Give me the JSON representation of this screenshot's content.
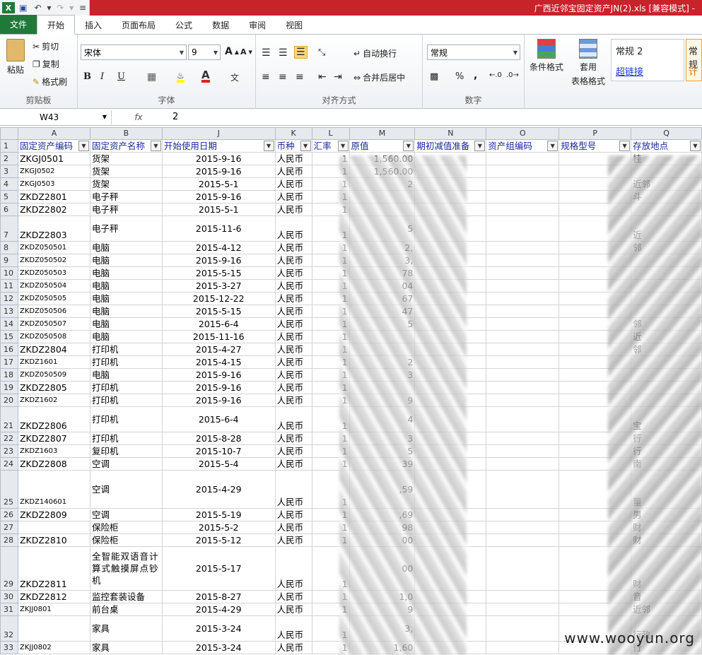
{
  "titlebar": {
    "title": "广西近邻宝固定资产JN(2).xls  [兼容模式] - "
  },
  "tabs": [
    {
      "label": "文件"
    },
    {
      "label": "开始"
    },
    {
      "label": "插入"
    },
    {
      "label": "页面布局"
    },
    {
      "label": "公式"
    },
    {
      "label": "数据"
    },
    {
      "label": "审阅"
    },
    {
      "label": "视图"
    }
  ],
  "ribbon": {
    "clipboard": {
      "paste": "粘贴",
      "cut": "剪切",
      "copy": "复制",
      "format_painter": "格式刷",
      "group": "剪贴板"
    },
    "font": {
      "name": "宋体",
      "size": "9",
      "bold": "B",
      "italic": "I",
      "underline": "U",
      "grow": "A",
      "shrink": "A",
      "group": "字体"
    },
    "alignment": {
      "wrap": "自动换行",
      "merge": "合并后居中",
      "group": "对齐方式"
    },
    "number": {
      "format": "常规",
      "percent": "%",
      "comma": ",",
      "group": "数字"
    },
    "styles": {
      "conditional": "条件格式",
      "table_format_line1": "套用",
      "table_format_line2": "表格格式",
      "style_normal2": "常规 2",
      "hyperlink": "超链接",
      "style_cut1": "常规",
      "style_cut2": "计"
    }
  },
  "formula": {
    "cell_ref": "W43",
    "fx": "fx",
    "value": "2"
  },
  "columns": [
    "A",
    "B",
    "J",
    "K",
    "L",
    "M",
    "N",
    "O",
    "P",
    "Q"
  ],
  "header_row": {
    "num": "1",
    "cells": [
      "固定资产编码",
      "固定资产名称",
      "开始使用日期",
      "币种",
      "汇率",
      "原值",
      "期初减值准备",
      "资产组编码",
      "规格型号",
      "存放地点"
    ]
  },
  "rows": [
    {
      "num": "2",
      "code": "ZKGJ0501",
      "name": "货架",
      "date": "2015-9-16",
      "cur": "人民币",
      "rate": "1",
      "val": "1,560.00",
      "loc": "桂"
    },
    {
      "num": "3",
      "code": "ZKGJ0502",
      "name": "货架",
      "date": "2015-9-16",
      "cur": "人民币",
      "rate": "1",
      "val": "1,560.00",
      "loc": "",
      "small": true
    },
    {
      "num": "4",
      "code": "ZKGJ0503",
      "name": "货架",
      "date": "2015-5-1",
      "cur": "人民币",
      "rate": "1",
      "val": "2",
      "loc": "近邻",
      "small": true
    },
    {
      "num": "5",
      "code": "ZKDZ2801",
      "name": "电子秤",
      "date": "2015-9-16",
      "cur": "人民币",
      "rate": "1",
      "val": "",
      "loc": "斗"
    },
    {
      "num": "6",
      "code": "ZKDZ2802",
      "name": "电子秤",
      "date": "2015-5-1",
      "cur": "人民币",
      "rate": "1",
      "val": "",
      "loc": ""
    },
    {
      "num": "7",
      "code": "ZKDZ2803",
      "name": "电子秤",
      "date": "2015-11-6",
      "cur": "人民币",
      "rate": "1",
      "val": "5",
      "loc": "近",
      "tall": true
    },
    {
      "num": "8",
      "code": "ZKDZ050501",
      "name": "电脑",
      "date": "2015-4-12",
      "cur": "人民币",
      "rate": "1",
      "val": "2,",
      "loc": "邻",
      "small": true
    },
    {
      "num": "9",
      "code": "ZKDZ050502",
      "name": "电脑",
      "date": "2015-9-16",
      "cur": "人民币",
      "rate": "1",
      "val": "3,",
      "loc": "",
      "small": true
    },
    {
      "num": "10",
      "code": "ZKDZ050503",
      "name": "电脑",
      "date": "2015-5-15",
      "cur": "人民币",
      "rate": "1",
      "val": "78",
      "loc": "",
      "small": true
    },
    {
      "num": "11",
      "code": "ZKDZ050504",
      "name": "电脑",
      "date": "2015-3-27",
      "cur": "人民币",
      "rate": "1",
      "val": "04",
      "loc": "",
      "small": true
    },
    {
      "num": "12",
      "code": "ZKDZ050505",
      "name": "电脑",
      "date": "2015-12-22",
      "cur": "人民币",
      "rate": "1",
      "val": "67",
      "loc": "",
      "small": true
    },
    {
      "num": "13",
      "code": "ZKDZ050506",
      "name": "电脑",
      "date": "2015-5-15",
      "cur": "人民币",
      "rate": "1",
      "val": "47",
      "loc": "",
      "small": true
    },
    {
      "num": "14",
      "code": "ZKDZ050507",
      "name": "电脑",
      "date": "2015-6-4",
      "cur": "人民币",
      "rate": "1",
      "val": "5",
      "loc": "邻",
      "small": true
    },
    {
      "num": "15",
      "code": "ZKDZ050508",
      "name": "电脑",
      "date": "2015-11-16",
      "cur": "人民币",
      "rate": "1",
      "val": "",
      "loc": "近",
      "small": true
    },
    {
      "num": "16",
      "code": "ZKDZ2804",
      "name": "打印机",
      "date": "2015-4-27",
      "cur": "人民币",
      "rate": "1",
      "val": "",
      "loc": "邻"
    },
    {
      "num": "17",
      "code": "ZKDZ1601",
      "name": "打印机",
      "date": "2015-4-15",
      "cur": "人民币",
      "rate": "1",
      "val": "2",
      "loc": "",
      "small": true
    },
    {
      "num": "18",
      "code": "ZKDZ050509",
      "name": "电脑",
      "date": "2015-9-16",
      "cur": "人民币",
      "rate": "1",
      "val": "3",
      "loc": "",
      "small": true
    },
    {
      "num": "19",
      "code": "ZKDZ2805",
      "name": "打印机",
      "date": "2015-9-16",
      "cur": "人民币",
      "rate": "1",
      "val": "",
      "loc": ""
    },
    {
      "num": "20",
      "code": "ZKDZ1602",
      "name": "打印机",
      "date": "2015-9-16",
      "cur": "人民币",
      "rate": "1",
      "val": "9",
      "loc": "",
      "small": true
    },
    {
      "num": "21",
      "code": "ZKDZ2806",
      "name": "打印机",
      "date": "2015-6-4",
      "cur": "人民币",
      "rate": "1",
      "val": "4",
      "loc": "宝",
      "tall": true
    },
    {
      "num": "22",
      "code": "ZKDZ2807",
      "name": "打印机",
      "date": "2015-8-28",
      "cur": "人民币",
      "rate": "1",
      "val": "3",
      "loc": "行"
    },
    {
      "num": "23",
      "code": "ZKDZ1603",
      "name": "复印机",
      "date": "2015-10-7",
      "cur": "人民币",
      "rate": "1",
      "val": "5",
      "loc": "行",
      "small": true
    },
    {
      "num": "24",
      "code": "ZKDZ2808",
      "name": "空调",
      "date": "2015-5-4",
      "cur": "人民币",
      "rate": "1",
      "val": "39",
      "loc": "南"
    },
    {
      "num": "25",
      "code": "ZKDZ140601",
      "name": "空调",
      "date": "2015-4-29",
      "cur": "人民币",
      "rate": "1",
      "val": ",59",
      "loc": "董",
      "small": true,
      "tall3": true
    },
    {
      "num": "26",
      "code": "ZKDZ2809",
      "name": "空调",
      "date": "2015-5-19",
      "cur": "人民币",
      "rate": "1",
      "val": ",69",
      "loc": "男"
    },
    {
      "num": "27",
      "code": "",
      "name": "保险柜",
      "date": "2015-5-2",
      "cur": "人民币",
      "rate": "1",
      "val": "98",
      "loc": "财"
    },
    {
      "num": "28",
      "code": "ZKDZ2810",
      "name": "保险柜",
      "date": "2015-5-12",
      "cur": "人民币",
      "rate": "1",
      "val": "00",
      "loc": "财"
    },
    {
      "num": "29",
      "code": "ZKDZ2811",
      "name": "全智能双语音计算式触摸屏点钞机",
      "date": "2015-5-17",
      "cur": "人民币",
      "rate": "1",
      "val": "00",
      "loc": "财",
      "tall4": true
    },
    {
      "num": "30",
      "code": "ZKDZ2812",
      "name": "监控套装设备",
      "date": "2015-8-27",
      "cur": "人民币",
      "rate": "1",
      "val": "1,0",
      "loc": "音"
    },
    {
      "num": "31",
      "code": "ZKJJ0801",
      "name": "前台桌",
      "date": "2015-4-29",
      "cur": "人民币",
      "rate": "1",
      "val": "9",
      "loc": "近邻",
      "small": true
    },
    {
      "num": "32",
      "code": "",
      "name": "家具",
      "date": "2015-3-24",
      "cur": "人民币",
      "rate": "1",
      "val": "3,",
      "loc": "行政",
      "tall": true
    },
    {
      "num": "33",
      "code": "ZKJJ0802",
      "name": "家具",
      "date": "2015-3-24",
      "cur": "人民币",
      "rate": "1",
      "val": "1,60",
      "loc": "行",
      "small": true
    }
  ],
  "watermark": "www.wooyun.org"
}
